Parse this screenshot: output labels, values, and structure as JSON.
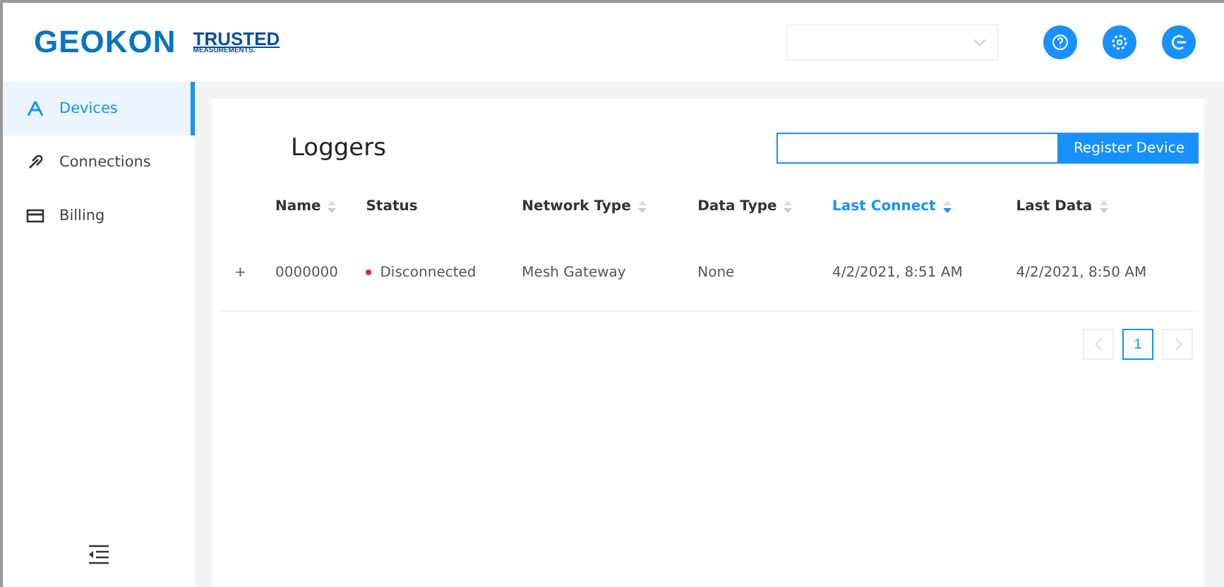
{
  "header": {
    "brand": "GEOKON",
    "tagline_top": "TRUSTED",
    "tagline_bottom": "MEASUREMENTS."
  },
  "sidebar": {
    "items": [
      {
        "label": "Devices",
        "kind": "devices",
        "selected": true
      },
      {
        "label": "Connections",
        "kind": "link",
        "selected": false
      },
      {
        "label": "Billing",
        "kind": "billing",
        "selected": false
      }
    ]
  },
  "page": {
    "title": "Loggers",
    "register_button": "Register Device"
  },
  "table": {
    "columns": [
      {
        "label": "Name",
        "sortable": true,
        "sorted": false
      },
      {
        "label": "Status",
        "sortable": false,
        "sorted": false
      },
      {
        "label": "Network Type",
        "sortable": true,
        "sorted": false
      },
      {
        "label": "Data Type",
        "sortable": true,
        "sorted": false
      },
      {
        "label": "Last Connect",
        "sortable": true,
        "sorted": true
      },
      {
        "label": "Last Data",
        "sortable": true,
        "sorted": false
      }
    ],
    "rows": [
      {
        "expand": "+",
        "name": "0000000",
        "status": "Disconnected",
        "color": "#f5222d",
        "network_type": "Mesh Gateway",
        "data_type": "None",
        "last_connect": "4/2/2021, 8:51 AM",
        "last_data": "4/2/2021, 8:50 AM"
      }
    ]
  },
  "pagination": {
    "pages": [
      {
        "label": "1",
        "selected": true
      }
    ]
  }
}
